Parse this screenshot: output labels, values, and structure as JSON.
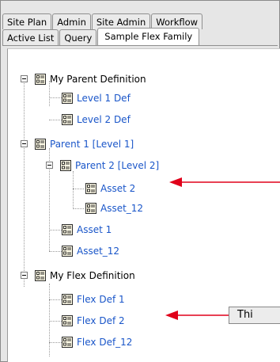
{
  "tabs_row1": [
    "Site Plan",
    "Admin",
    "Site Admin",
    "Workflow"
  ],
  "tabs_row2": [
    "Active List",
    "Query",
    "Sample Flex Family"
  ],
  "active_tab": "Sample Flex Family",
  "tree": [
    {
      "label": "My Parent Definition"
    },
    {
      "label": "Level 1 Def"
    },
    {
      "label": "Level 2 Def"
    },
    {
      "label": "Parent 1 [Level 1]"
    },
    {
      "label": "Parent 2 [Level 2]"
    },
    {
      "label": "Asset 2"
    },
    {
      "label": "Asset_12"
    },
    {
      "label": "Asset 1"
    },
    {
      "label": "Asset_12"
    },
    {
      "label": "My Flex Definition"
    },
    {
      "label": "Flex Def 1"
    },
    {
      "label": "Flex Def 2"
    },
    {
      "label": "Flex Def_12"
    }
  ],
  "callout_text": "Thi",
  "colors": {
    "link": "#1a56c9",
    "arrow": "#e0001a"
  }
}
